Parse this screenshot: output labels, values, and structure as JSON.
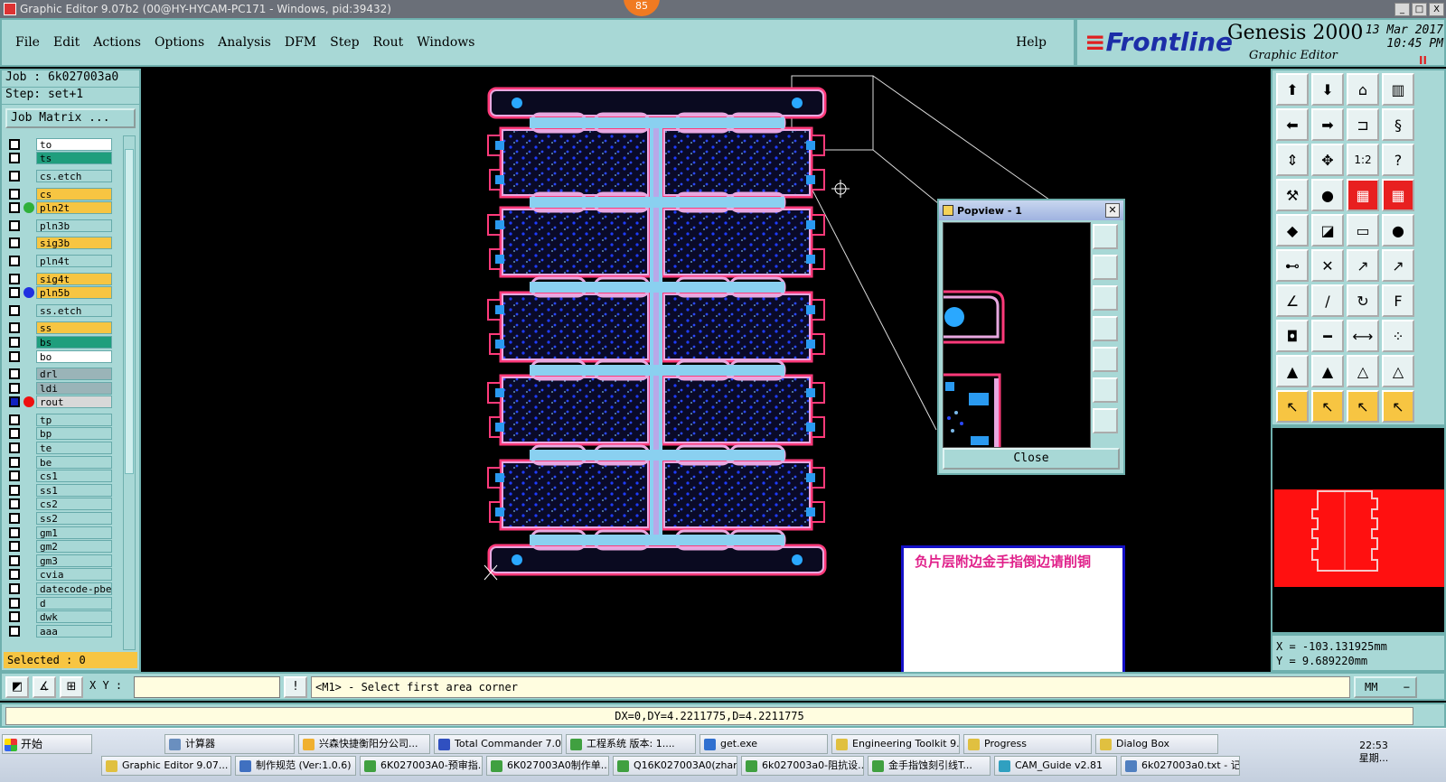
{
  "window": {
    "title": "Graphic Editor 9.07b2 (00@HY-HYCAM-PC171 - Windows, pid:39432)",
    "badge": "85",
    "controls": [
      "_",
      "□",
      "X"
    ]
  },
  "menu": {
    "items": [
      "File",
      "Edit",
      "Actions",
      "Options",
      "Analysis",
      "DFM",
      "Step",
      "Rout",
      "Windows"
    ],
    "help": "Help"
  },
  "brand": {
    "logo": "Frontline",
    "product": "Genesis 2000",
    "subtitle": "Graphic Editor",
    "date": "13 Mar 2017",
    "time": "10:45 PM",
    "pause": "II"
  },
  "left": {
    "job": "Job : 6k027003a0",
    "step": "Step: set+1",
    "job_matrix": "Job Matrix ...",
    "selected": "Selected : 0",
    "layers": [
      {
        "name": "to",
        "color": "#ffffff"
      },
      {
        "name": "ts",
        "color": "#1f9e7d"
      },
      {
        "gap": true
      },
      {
        "name": "cs.etch",
        "color": "#a8d8d6"
      },
      {
        "gap": true
      },
      {
        "name": "cs",
        "color": "#f7c542"
      },
      {
        "name": "pln2t",
        "color": "#f7c542",
        "dot": "#2fb03a"
      },
      {
        "gap": true
      },
      {
        "name": "pln3b",
        "color": "#a8d8d6"
      },
      {
        "gap": true
      },
      {
        "name": "sig3b",
        "color": "#f7c542"
      },
      {
        "gap": true
      },
      {
        "name": "pln4t",
        "color": "#a8d8d6"
      },
      {
        "gap": true
      },
      {
        "name": "sig4t",
        "color": "#f7c542"
      },
      {
        "name": "pln5b",
        "color": "#f7c542",
        "dot": "#2030e0"
      },
      {
        "gap": true
      },
      {
        "name": "ss.etch",
        "color": "#a8d8d6"
      },
      {
        "gap": true
      },
      {
        "name": "ss",
        "color": "#f7c542"
      },
      {
        "name": "bs",
        "color": "#1f9e7d"
      },
      {
        "name": "bo",
        "color": "#ffffff"
      },
      {
        "gap": true
      },
      {
        "name": "drl",
        "color": "#9ab4b8"
      },
      {
        "name": "ldi",
        "color": "#9ab4b8"
      },
      {
        "name": "rout",
        "color": "#d8d8d8",
        "dot": "#ee1010",
        "marked": true
      },
      {
        "gap": true
      },
      {
        "name": "tp",
        "color": "#a8d8d6"
      },
      {
        "name": "bp",
        "color": "#a8d8d6"
      },
      {
        "name": "te",
        "color": "#a8d8d6"
      },
      {
        "name": "be",
        "color": "#a8d8d6"
      },
      {
        "name": "cs1",
        "color": "#a8d8d6"
      },
      {
        "name": "ss1",
        "color": "#a8d8d6"
      },
      {
        "name": "cs2",
        "color": "#a8d8d6"
      },
      {
        "name": "ss2",
        "color": "#a8d8d6"
      },
      {
        "name": "gm1",
        "color": "#a8d8d6"
      },
      {
        "name": "gm2",
        "color": "#a8d8d6"
      },
      {
        "name": "gm3",
        "color": "#a8d8d6"
      },
      {
        "name": "cvia",
        "color": "#a8d8d6"
      },
      {
        "name": "datecode-pbe",
        "color": "#a8d8d6"
      },
      {
        "name": "d",
        "color": "#a8d8d6"
      },
      {
        "name": "dwk",
        "color": "#a8d8d6"
      },
      {
        "name": "aaa",
        "color": "#a8d8d6"
      }
    ]
  },
  "popview": {
    "title": "Popview - 1",
    "close_label": "Close"
  },
  "note": {
    "text": "负片层附边金手指倒边请削铜"
  },
  "tools": {
    "labels": {
      "ratio": "1:2",
      "help": "?"
    }
  },
  "coords": {
    "x": "X = -103.131925mm",
    "y": "Y = 9.689220mm"
  },
  "command": {
    "xy_label": "X Y :",
    "xy_value": "",
    "prompt": "<M1> - Select first area corner",
    "unit": "MM"
  },
  "status": {
    "text": "DX=0,DY=4.2211775,D=4.2211775"
  },
  "taskbar": {
    "start": "开始",
    "row1": [
      {
        "label": "计算器",
        "color": "#6a8fbf"
      },
      {
        "label": "兴森快捷衡阳分公司...",
        "color": "#f0b030"
      },
      {
        "label": "Total Commander 7.0 ...",
        "color": "#3050c0"
      },
      {
        "label": "工程系统  版本: 1....",
        "color": "#40a040"
      },
      {
        "label": "get.exe",
        "color": "#3070d0"
      },
      {
        "label": "Engineering Toolkit 9....",
        "color": "#e0c040"
      },
      {
        "label": "Progress",
        "color": "#e0c040"
      },
      {
        "label": "Dialog Box",
        "color": "#e0c040"
      }
    ],
    "row2": [
      {
        "label": "Graphic Editor 9.07...",
        "color": "#e0c040"
      },
      {
        "label": "制作规范 (Ver:1.0.6)",
        "color": "#4070c0"
      },
      {
        "label": "6K027003A0-预审指...",
        "color": "#40a040"
      },
      {
        "label": "6K027003A0制作单...",
        "color": "#40a040"
      },
      {
        "label": "Q16K027003A0(zhan...",
        "color": "#40a040"
      },
      {
        "label": "6k027003a0-阻抗设...",
        "color": "#40a040"
      },
      {
        "label": "金手指蚀刻引线T...",
        "color": "#40a040"
      },
      {
        "label": "CAM_Guide v2.81",
        "color": "#30a0c0"
      },
      {
        "label": "6k027003a0.txt - 记...",
        "color": "#5080c0"
      }
    ],
    "clock": "22:53",
    "weekday": "星期..."
  }
}
